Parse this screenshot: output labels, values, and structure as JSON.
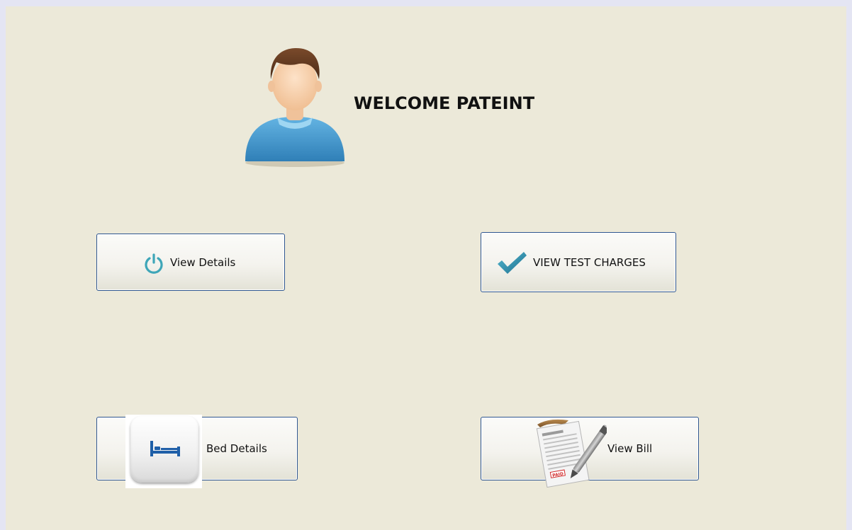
{
  "header": {
    "welcome_text": "WELCOME PATEINT"
  },
  "buttons": {
    "view_details": "View Details",
    "view_test_charges": "VIEW TEST CHARGES",
    "bed_details": "Bed Details",
    "view_bill": "View Bill"
  },
  "icons": {
    "avatar": "patient-avatar-icon",
    "view_details": "power-icon",
    "view_test_charges": "checkmark-icon",
    "bed_details": "bed-icon",
    "view_bill": "paid-bill-clipboard-icon"
  },
  "colors": {
    "background": "#ece9d9",
    "button_border": "#2f568f",
    "power_icon": "#3ea6b8",
    "check_icon": "#2f8ea8",
    "bed_icon": "#1f5fa8",
    "avatar_shirt": "#4a9bd2"
  },
  "bill_stamp": "PAID"
}
